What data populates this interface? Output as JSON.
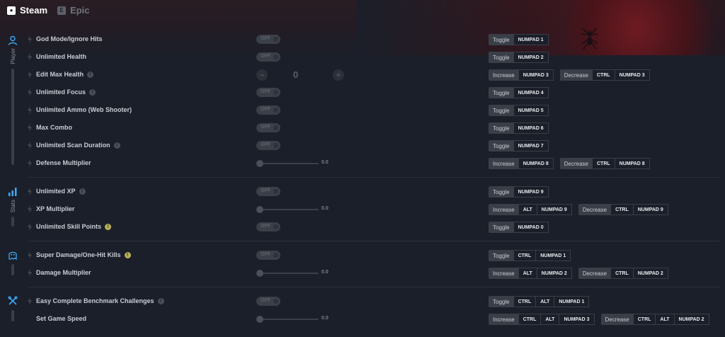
{
  "platforms": [
    {
      "label": "Steam",
      "active": true
    },
    {
      "label": "Epic",
      "active": false
    }
  ],
  "categories": [
    {
      "id": "player",
      "label": "Player",
      "icon": "person-icon"
    },
    {
      "id": "stats",
      "label": "Stats",
      "icon": "bar-chart-icon"
    },
    {
      "id": "enemies",
      "label": "",
      "icon": "ghost-icon"
    },
    {
      "id": "misc",
      "label": "",
      "icon": "crossed-tools-icon"
    }
  ],
  "rows": [
    {
      "name": "God Mode/Ignore Hits",
      "info": "none",
      "control": "toggle",
      "state": "OFF",
      "hotkeys": [
        {
          "action": "Toggle",
          "keys": [
            "NUMPAD 1"
          ]
        }
      ]
    },
    {
      "name": "Unlimited Health",
      "info": "none",
      "control": "toggle",
      "state": "OFF",
      "hotkeys": [
        {
          "action": "Toggle",
          "keys": [
            "NUMPAD 2"
          ]
        }
      ]
    },
    {
      "name": "Edit Max Health",
      "info": "info",
      "control": "stepper",
      "value": "0",
      "hotkeys": [
        {
          "action": "Increase",
          "keys": [
            "NUMPAD 3"
          ]
        },
        {
          "action": "Decrease",
          "keys": [
            "CTRL",
            "NUMPAD 3"
          ]
        }
      ]
    },
    {
      "name": "Unlimited Focus",
      "info": "info",
      "control": "toggle",
      "state": "OFF",
      "hotkeys": [
        {
          "action": "Toggle",
          "keys": [
            "NUMPAD 4"
          ]
        }
      ]
    },
    {
      "name": "Unlimited Ammo (Web Shooter)",
      "info": "none",
      "control": "toggle",
      "state": "OFF",
      "hotkeys": [
        {
          "action": "Toggle",
          "keys": [
            "NUMPAD 5"
          ]
        }
      ]
    },
    {
      "name": "Max Combo",
      "info": "none",
      "control": "toggle",
      "state": "OFF",
      "hotkeys": [
        {
          "action": "Toggle",
          "keys": [
            "NUMPAD 6"
          ]
        }
      ]
    },
    {
      "name": "Unlimited Scan Duration",
      "info": "info",
      "control": "toggle",
      "state": "OFF",
      "hotkeys": [
        {
          "action": "Toggle",
          "keys": [
            "NUMPAD 7"
          ]
        }
      ]
    },
    {
      "name": "Defense Multiplier",
      "info": "none",
      "control": "slider",
      "value": "0.0",
      "hotkeys": [
        {
          "action": "Increase",
          "keys": [
            "NUMPAD 8"
          ]
        },
        {
          "action": "Decrease",
          "keys": [
            "CTRL",
            "NUMPAD 8"
          ]
        }
      ]
    },
    {
      "name": "Unlimited XP",
      "info": "info",
      "control": "toggle",
      "state": "OFF",
      "hotkeys": [
        {
          "action": "Toggle",
          "keys": [
            "NUMPAD 9"
          ]
        }
      ]
    },
    {
      "name": "XP Multiplier",
      "info": "none",
      "control": "slider",
      "value": "0.0",
      "hotkeys": [
        {
          "action": "Increase",
          "keys": [
            "ALT",
            "NUMPAD 9"
          ]
        },
        {
          "action": "Decrease",
          "keys": [
            "CTRL",
            "NUMPAD 9"
          ]
        }
      ]
    },
    {
      "name": "Unlimited Skill Points",
      "info": "warn",
      "control": "toggle",
      "state": "OFF",
      "hotkeys": [
        {
          "action": "Toggle",
          "keys": [
            "NUMPAD 0"
          ]
        }
      ]
    },
    {
      "name": "Super Damage/One-Hit Kills",
      "info": "warn",
      "control": "toggle",
      "state": "OFF",
      "hotkeys": [
        {
          "action": "Toggle",
          "keys": [
            "CTRL",
            "NUMPAD 1"
          ]
        }
      ]
    },
    {
      "name": "Damage Multiplier",
      "info": "none",
      "control": "slider",
      "value": "0.0",
      "hotkeys": [
        {
          "action": "Increase",
          "keys": [
            "ALT",
            "NUMPAD 2"
          ]
        },
        {
          "action": "Decrease",
          "keys": [
            "CTRL",
            "NUMPAD 2"
          ]
        }
      ]
    },
    {
      "name": "Easy Complete Benchmark Challenges",
      "info": "info",
      "control": "toggle",
      "state": "OFF",
      "hotkeys": [
        {
          "action": "Toggle",
          "keys": [
            "CTRL",
            "ALT",
            "NUMPAD 1"
          ]
        }
      ]
    },
    {
      "name": "Set Game Speed",
      "info": "none",
      "control": "slider",
      "value": "0.0",
      "hotkeys": [
        {
          "action": "Increase",
          "keys": [
            "CTRL",
            "ALT",
            "NUMPAD 3"
          ]
        },
        {
          "action": "Decrease",
          "keys": [
            "CTRL",
            "ALT",
            "NUMPAD 2"
          ]
        }
      ]
    }
  ],
  "theme": {
    "accent": "#3fa9f5",
    "background": "#1b1f29",
    "warn": "#b8b25a"
  }
}
